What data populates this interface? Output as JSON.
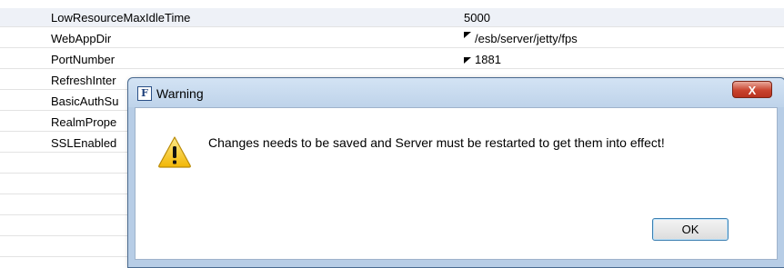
{
  "properties": [
    {
      "name": "LowResourceMaxIdleTime",
      "value": "5000",
      "flag": false
    },
    {
      "name": "WebAppDir",
      "value": "/esb/server/jetty/fps",
      "flag": true
    },
    {
      "name": "PortNumber",
      "value": "1881",
      "flag": true
    },
    {
      "name": "RefreshInter",
      "value": "",
      "flag": false
    },
    {
      "name": "BasicAuthSu",
      "value": "",
      "flag": false
    },
    {
      "name": "RealmPrope",
      "value": "",
      "flag": false
    },
    {
      "name": "SSLEnabled",
      "value": "",
      "flag": false
    }
  ],
  "dialog": {
    "title": "Warning",
    "app_icon_letter": "F",
    "close_glyph": "X",
    "message": "Changes needs to be saved and Server must be restarted to get them into effect!",
    "ok_label": "OK",
    "icon": "warning-icon"
  },
  "colors": {
    "dialog_frame": "#b7cde6",
    "close_button": "#c9442f",
    "warning_yellow": "#f6c01a"
  }
}
